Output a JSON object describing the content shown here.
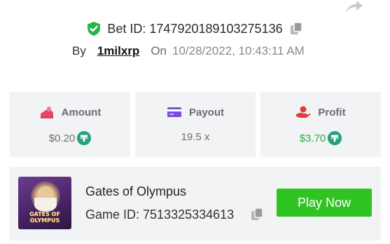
{
  "header": {
    "share_icon": "share-icon"
  },
  "bet": {
    "verified_icon": "shield-check-icon",
    "label": "Bet ID: 1747920189103275136",
    "copy_icon": "copy-icon"
  },
  "meta": {
    "by_label": "By",
    "username": "1milxrp",
    "on_label": "On",
    "date": "10/28/2022, 10:43:11 AM"
  },
  "stats": [
    {
      "key": "amount",
      "label": "Amount",
      "icon": "wallet-icon",
      "value": "$0.20",
      "currency_icon": "tether-icon"
    },
    {
      "key": "payout",
      "label": "Payout",
      "icon": "card-icon",
      "value": "19.5 x"
    },
    {
      "key": "profit",
      "label": "Profit",
      "icon": "hand-coin-icon",
      "value": "$3.70",
      "currency_icon": "tether-icon"
    }
  ],
  "game": {
    "thumbnail_text": "GATES OF OLYMPUS",
    "title": "Gates of Olympus",
    "id_label": "Game ID: 7513325334613",
    "copy_icon": "copy-icon",
    "play_label": "Play Now"
  },
  "colors": {
    "accent_green": "#30c423",
    "profit_green": "#33a840",
    "amount_pink": "#e8446a",
    "payout_purple": "#7b4de0",
    "profit_red": "#e03c3c",
    "tether_teal": "#26a17b"
  }
}
